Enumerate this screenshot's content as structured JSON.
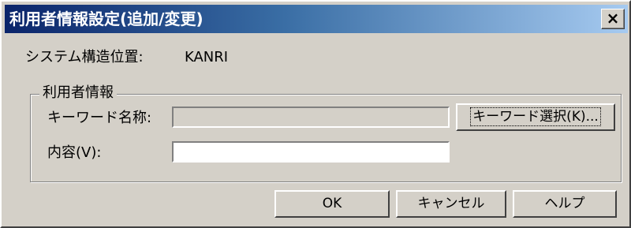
{
  "window": {
    "title": "利用者情報設定(追加/変更)",
    "close_glyph": "×"
  },
  "system": {
    "label": "システム構造位置:",
    "value": "KANRI"
  },
  "group": {
    "legend": "利用者情報",
    "keyword_label": "キーワード名称:",
    "keyword_value": "",
    "keyword_button": "キーワード選択(K)...",
    "content_label": "内容(V):",
    "content_value": ""
  },
  "buttons": {
    "ok": "OK",
    "cancel": "キャンセル",
    "help": "ヘルプ"
  },
  "colors": {
    "titlebar_start": "#0a246a",
    "titlebar_end": "#a6caf0",
    "dialog_face": "#d4d0c8"
  }
}
